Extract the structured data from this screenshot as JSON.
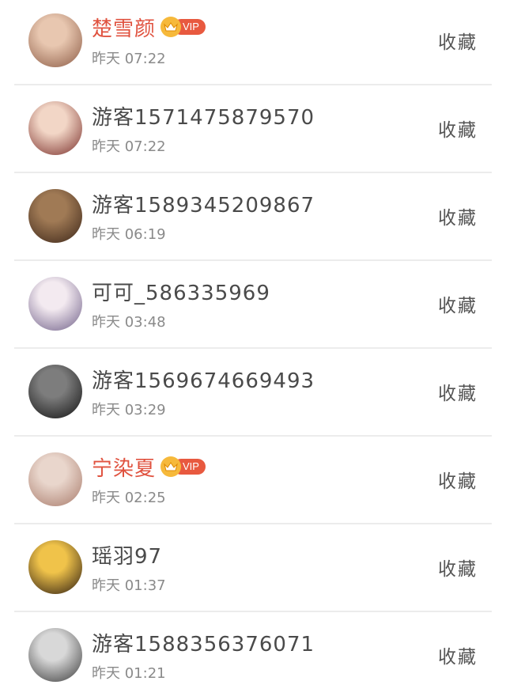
{
  "items": [
    {
      "name": "楚雪颜",
      "vip": true,
      "vip_label": "VIP",
      "time": "昨天 07:22",
      "action": "收藏",
      "avatar_bg": [
        "#e8c7b0",
        "#8b5a44"
      ]
    },
    {
      "name": "游客1571475879570",
      "vip": false,
      "time": "昨天 07:22",
      "action": "收藏",
      "avatar_bg": [
        "#f2d6c6",
        "#7a2e2a"
      ]
    },
    {
      "name": "游客1589345209867",
      "vip": false,
      "time": "昨天 06:19",
      "action": "收藏",
      "avatar_bg": [
        "#a07a55",
        "#3b2518"
      ]
    },
    {
      "name": "可可_586335969",
      "vip": false,
      "time": "昨天 03:48",
      "action": "收藏",
      "avatar_bg": [
        "#f3eaf0",
        "#6f5f88"
      ]
    },
    {
      "name": "游客1569674669493",
      "vip": false,
      "time": "昨天 03:29",
      "action": "收藏",
      "avatar_bg": [
        "#7d7d7d",
        "#111111"
      ]
    },
    {
      "name": "宁染夏",
      "vip": true,
      "vip_label": "VIP",
      "time": "昨天 02:25",
      "action": "收藏",
      "avatar_bg": [
        "#e9d6cc",
        "#a87a6a"
      ]
    },
    {
      "name": "瑶羽97",
      "vip": false,
      "time": "昨天 01:37",
      "action": "收藏",
      "avatar_bg": [
        "#f0c34a",
        "#2a1a10"
      ]
    },
    {
      "name": "游客1588356376071",
      "vip": false,
      "time": "昨天 01:21",
      "action": "收藏",
      "avatar_bg": [
        "#d8d8d8",
        "#3a3a3a"
      ]
    }
  ],
  "colors": {
    "vip_name": "#e0523f",
    "vip_badge": "#e8593f",
    "vip_crown": "#f6b93b"
  }
}
